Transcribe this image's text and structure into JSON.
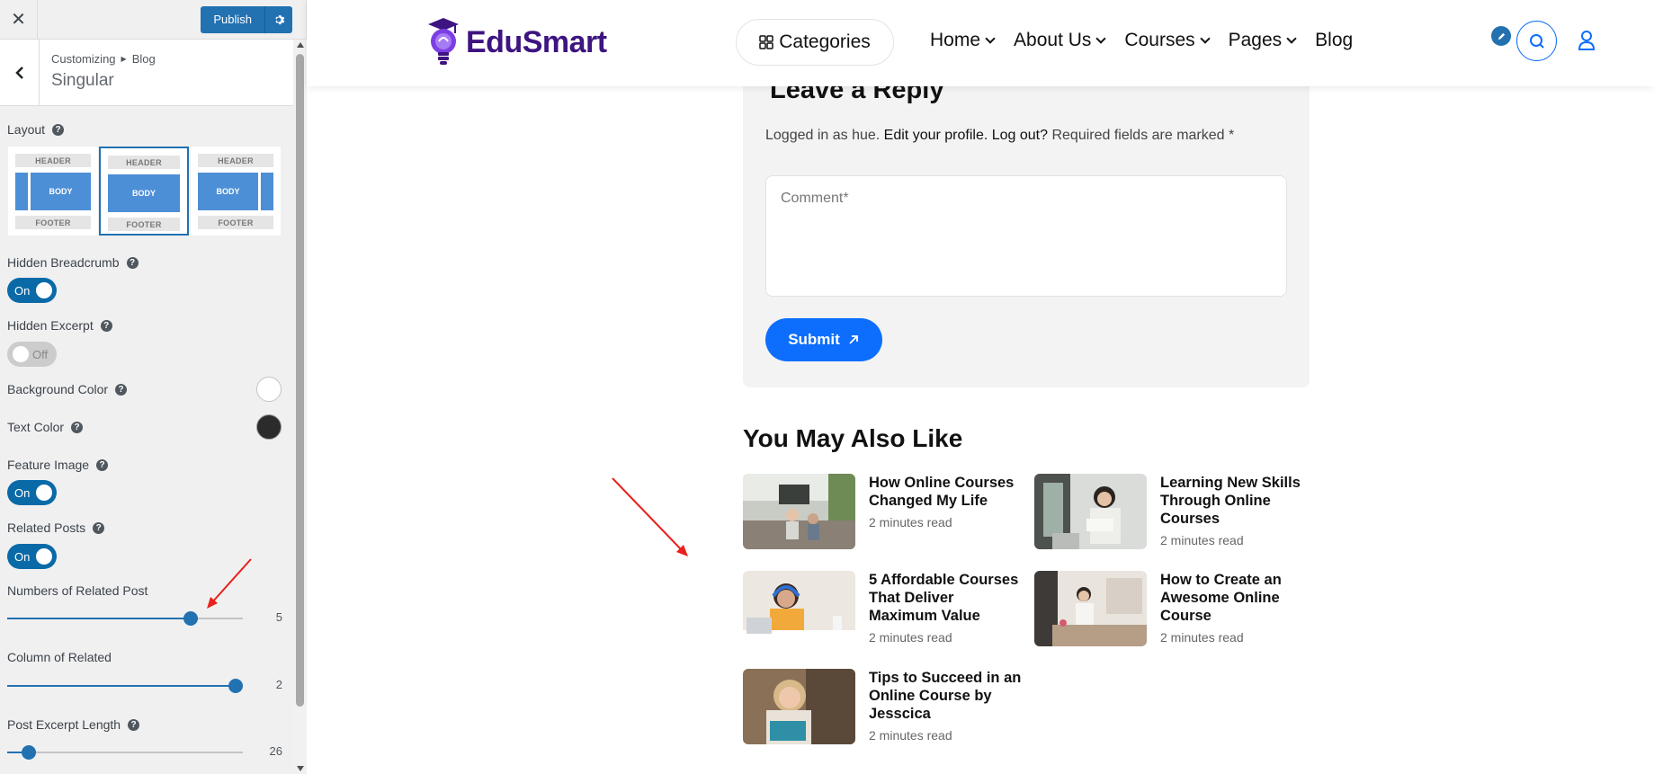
{
  "customizer": {
    "close_label": "✕",
    "publish_label": "Publish",
    "breadcrumb": [
      "Customizing",
      "Blog"
    ],
    "section_title": "Singular",
    "layout": {
      "label": "Layout",
      "options": [
        {
          "header": "HEADER",
          "body": "BODY",
          "footer": "FOOTER",
          "sidebar": "left",
          "selected": false
        },
        {
          "header": "HEADER",
          "body": "BODY",
          "footer": "FOOTER",
          "sidebar": "none",
          "selected": true
        },
        {
          "header": "HEADER",
          "body": "BODY",
          "footer": "FOOTER",
          "sidebar": "right",
          "selected": false
        }
      ]
    },
    "hidden_breadcrumb": {
      "label": "Hidden Breadcrumb",
      "state": "On"
    },
    "hidden_excerpt": {
      "label": "Hidden Excerpt",
      "state": "Off"
    },
    "background_color": {
      "label": "Background Color",
      "value": "#ffffff"
    },
    "text_color": {
      "label": "Text Color",
      "value": "#2b2b2b"
    },
    "feature_image": {
      "label": "Feature Image",
      "state": "On"
    },
    "related_posts": {
      "label": "Related Posts",
      "state": "On"
    },
    "numbers_related": {
      "label": "Numbers of Related Post",
      "value": "5",
      "fill_fraction": 0.78
    },
    "column_related": {
      "label": "Column of Related",
      "value": "2",
      "fill_fraction": 0.97
    },
    "excerpt_length": {
      "label": "Post Excerpt Length",
      "value": "26",
      "fill_fraction": 0.09
    }
  },
  "site": {
    "logo_text": "EduSmart",
    "categories_label": "Categories",
    "nav": [
      {
        "label": "Home",
        "dropdown": true
      },
      {
        "label": "About Us",
        "dropdown": true
      },
      {
        "label": "Courses",
        "dropdown": true
      },
      {
        "label": "Pages",
        "dropdown": true
      },
      {
        "label": "Blog",
        "dropdown": false
      }
    ],
    "reply": {
      "title": "Leave a Reply",
      "logged_prefix": "Logged in as hue. ",
      "edit_profile": "Edit your profile.",
      "logout": "Log out?",
      "required": " Required fields are marked *",
      "comment_placeholder": "Comment*",
      "submit_label": "Submit"
    },
    "related": {
      "title": "You May Also Like",
      "posts": [
        {
          "title": "How Online Courses Changed My Life",
          "meta": "2 minutes read"
        },
        {
          "title": "Learning New Skills Through Online Courses",
          "meta": "2 minutes read"
        },
        {
          "title": "5 Affordable Courses That Deliver Maximum Value",
          "meta": "2 minutes read"
        },
        {
          "title": "How to Create an Awesome Online Course",
          "meta": "2 minutes read"
        },
        {
          "title": "Tips to Succeed in an Online Course by Jesscica",
          "meta": "2 minutes read"
        }
      ]
    }
  },
  "colors": {
    "wp_blue": "#2271b1",
    "toggle_on": "#0a6aa8",
    "brand_purple": "#3d1480",
    "submit_blue": "#0d6efd",
    "annotation_red": "#e8221b"
  }
}
